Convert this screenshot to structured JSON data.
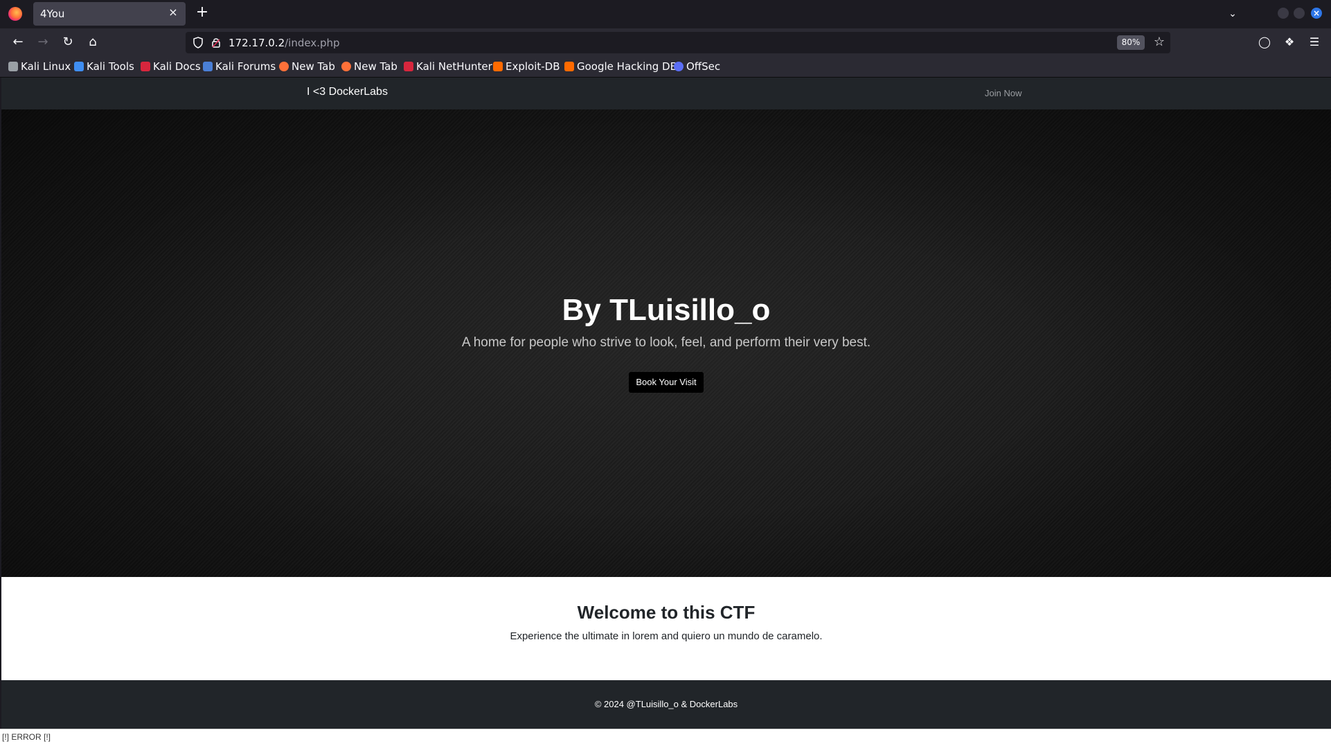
{
  "browser": {
    "tab_title": "4You",
    "tab_close": "×",
    "new_tab": "+",
    "url_host": "172.17.0.2",
    "url_path": "/index.php",
    "zoom": "80%",
    "bookmarks": [
      {
        "label": "Kali Linux",
        "icon": "kali-icon",
        "color": "#9aa0a6"
      },
      {
        "label": "Kali Tools",
        "icon": "kali-tools-icon",
        "color": "#3f8ef2"
      },
      {
        "label": "Kali Docs",
        "icon": "kali-docs-icon",
        "color": "#d7263d"
      },
      {
        "label": "Kali Forums",
        "icon": "kali-forums-icon",
        "color": "#4a7fd6"
      },
      {
        "label": "New Tab",
        "icon": "firefox-icon",
        "color": "#ff7139"
      },
      {
        "label": "New Tab",
        "icon": "firefox-icon",
        "color": "#ff7139"
      },
      {
        "label": "Kali NetHunter",
        "icon": "nethunter-icon",
        "color": "#d7263d"
      },
      {
        "label": "Exploit-DB",
        "icon": "exploitdb-icon",
        "color": "#ff6a00"
      },
      {
        "label": "Google Hacking DB",
        "icon": "ghdb-icon",
        "color": "#ff6a00"
      },
      {
        "label": "OffSec",
        "icon": "offsec-icon",
        "color": "#5b6ef5"
      }
    ]
  },
  "site": {
    "brand": "I <3 DockerLabs",
    "nav_join": "Join Now",
    "hero": {
      "title": "By TLuisillo_o",
      "subtitle": "A home for people who strive to look, feel, and perform their very best.",
      "button": "Book Your Visit"
    },
    "welcome": {
      "title": "Welcome to this CTF",
      "text": "Experience the ultimate in lorem and quiero un mundo de caramelo."
    },
    "footer": "© 2024 @TLuisillo_o & DockerLabs",
    "error": "[!] ERROR [!]"
  }
}
